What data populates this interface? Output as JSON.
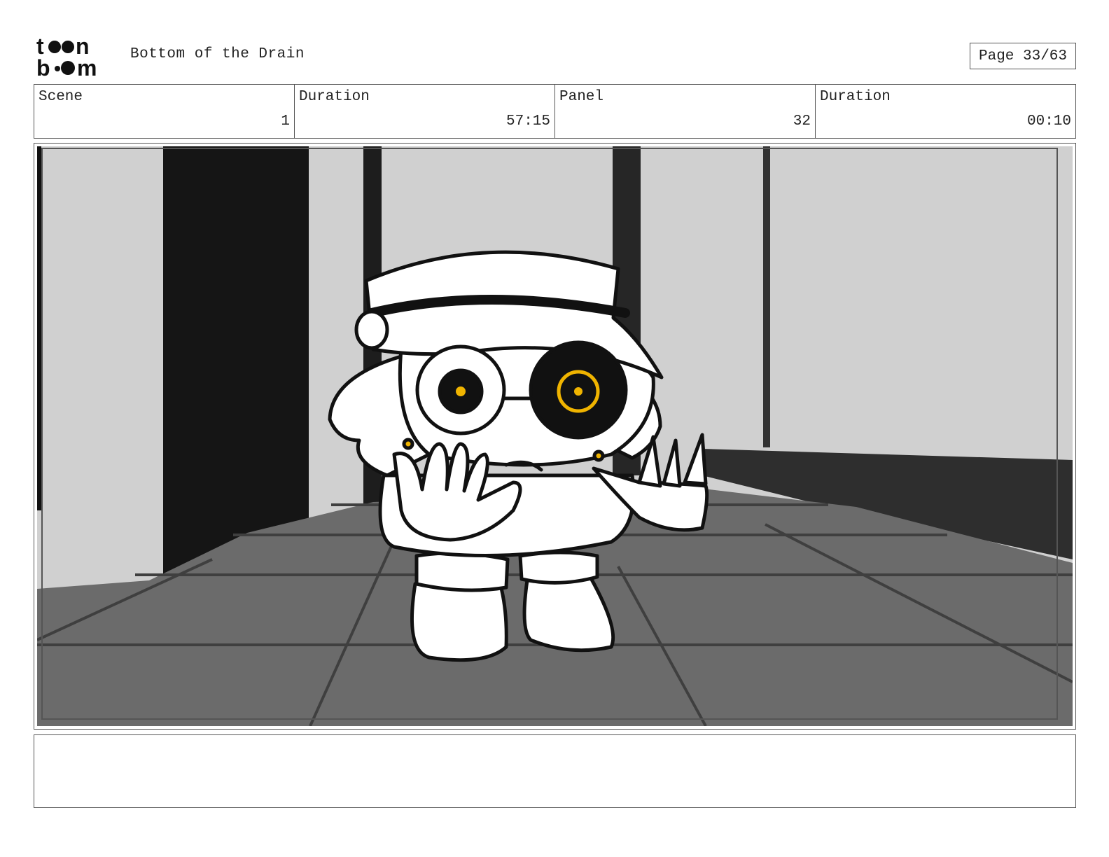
{
  "header": {
    "logo_text": "toon boom",
    "title": "Bottom of the Drain",
    "page": "Page 33/63"
  },
  "info": [
    {
      "label": "Scene",
      "value": "1"
    },
    {
      "label": "Duration",
      "value": "57:15"
    },
    {
      "label": "Panel",
      "value": "32"
    },
    {
      "label": "Duration",
      "value": "00:10"
    }
  ],
  "panel_image": {
    "description_icon": "storyboard-frame-image",
    "accent_color": "#f0b400"
  },
  "notes": {
    "text": ""
  }
}
